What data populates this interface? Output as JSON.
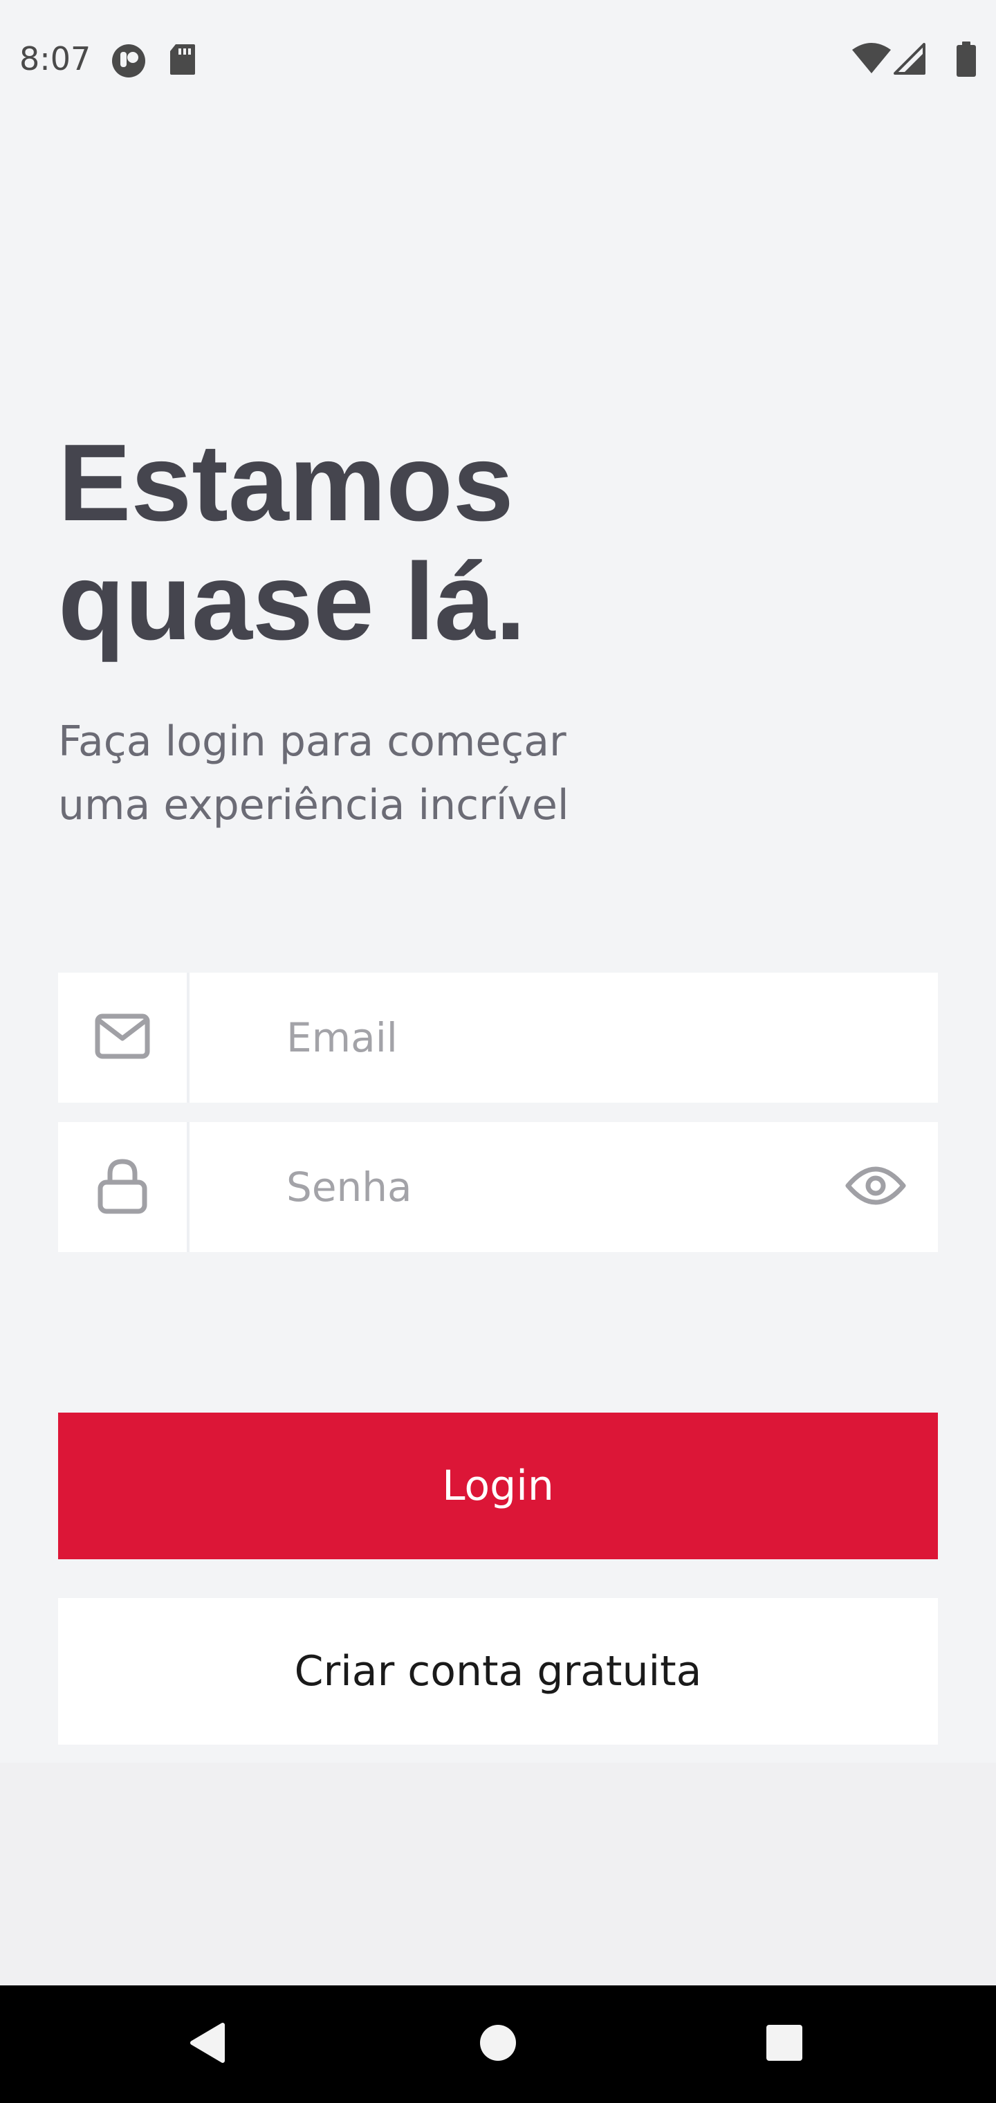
{
  "status_bar": {
    "time": "8:07",
    "icons": [
      "app-notification-icon",
      "sd-card-icon",
      "wifi-icon",
      "cell-signal-icon",
      "battery-icon"
    ]
  },
  "header": {
    "title_line1": "Estamos",
    "title_line2": "quase lá.",
    "subtitle_line1": "Faça login para começar",
    "subtitle_line2": "uma experiência incrível"
  },
  "form": {
    "email": {
      "placeholder": "Email",
      "value": "",
      "icon": "mail-icon"
    },
    "password": {
      "placeholder": "Senha",
      "value": "",
      "icon": "lock-icon",
      "toggle_icon": "eye-icon"
    }
  },
  "actions": {
    "login_label": "Login",
    "signup_label": "Criar conta gratuita"
  },
  "colors": {
    "accent": "#dc1637",
    "background": "#f3f4f6",
    "title": "#45454e",
    "subtitle": "#6b6b75",
    "placeholder": "#a3a3a8",
    "icon": "#a0a0a5"
  },
  "nav_bar": {
    "icons": [
      "back-icon",
      "home-icon",
      "recents-icon"
    ]
  }
}
